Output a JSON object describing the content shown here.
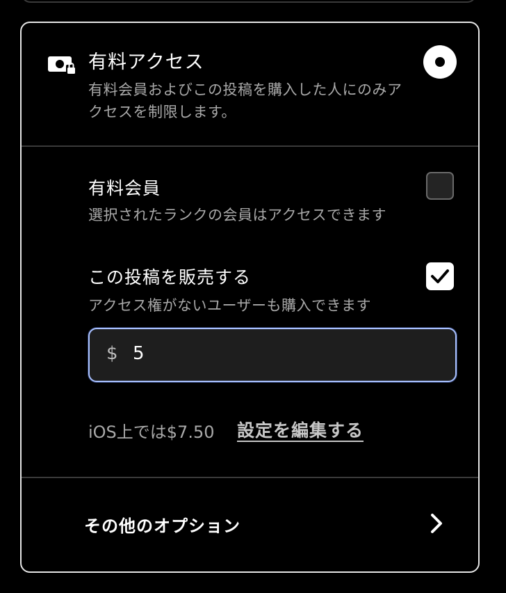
{
  "access": {
    "title": "有料アクセス",
    "description": "有料会員およびこの投稿を購入した人にのみアクセスを制限します。",
    "selected": true,
    "icon": "paid-lock-icon"
  },
  "options": {
    "paid_members": {
      "title": "有料会員",
      "description": "選択されたランクの会員はアクセスできます",
      "checked": false
    },
    "sell_post": {
      "title": "この投稿を販売する",
      "description": "アクセス権がないユーザーも購入できます",
      "checked": true
    }
  },
  "price": {
    "currency": "$",
    "value": "5"
  },
  "ios_note": {
    "text": "iOS上では$7.50",
    "link": "設定を編集する"
  },
  "more_options": {
    "label": "その他のオプション",
    "icon": "chevron-right-icon"
  },
  "colors": {
    "focus_ring": "#a9c1ff",
    "muted_text": "#a9a9a9",
    "border": "#e6e6e6"
  }
}
